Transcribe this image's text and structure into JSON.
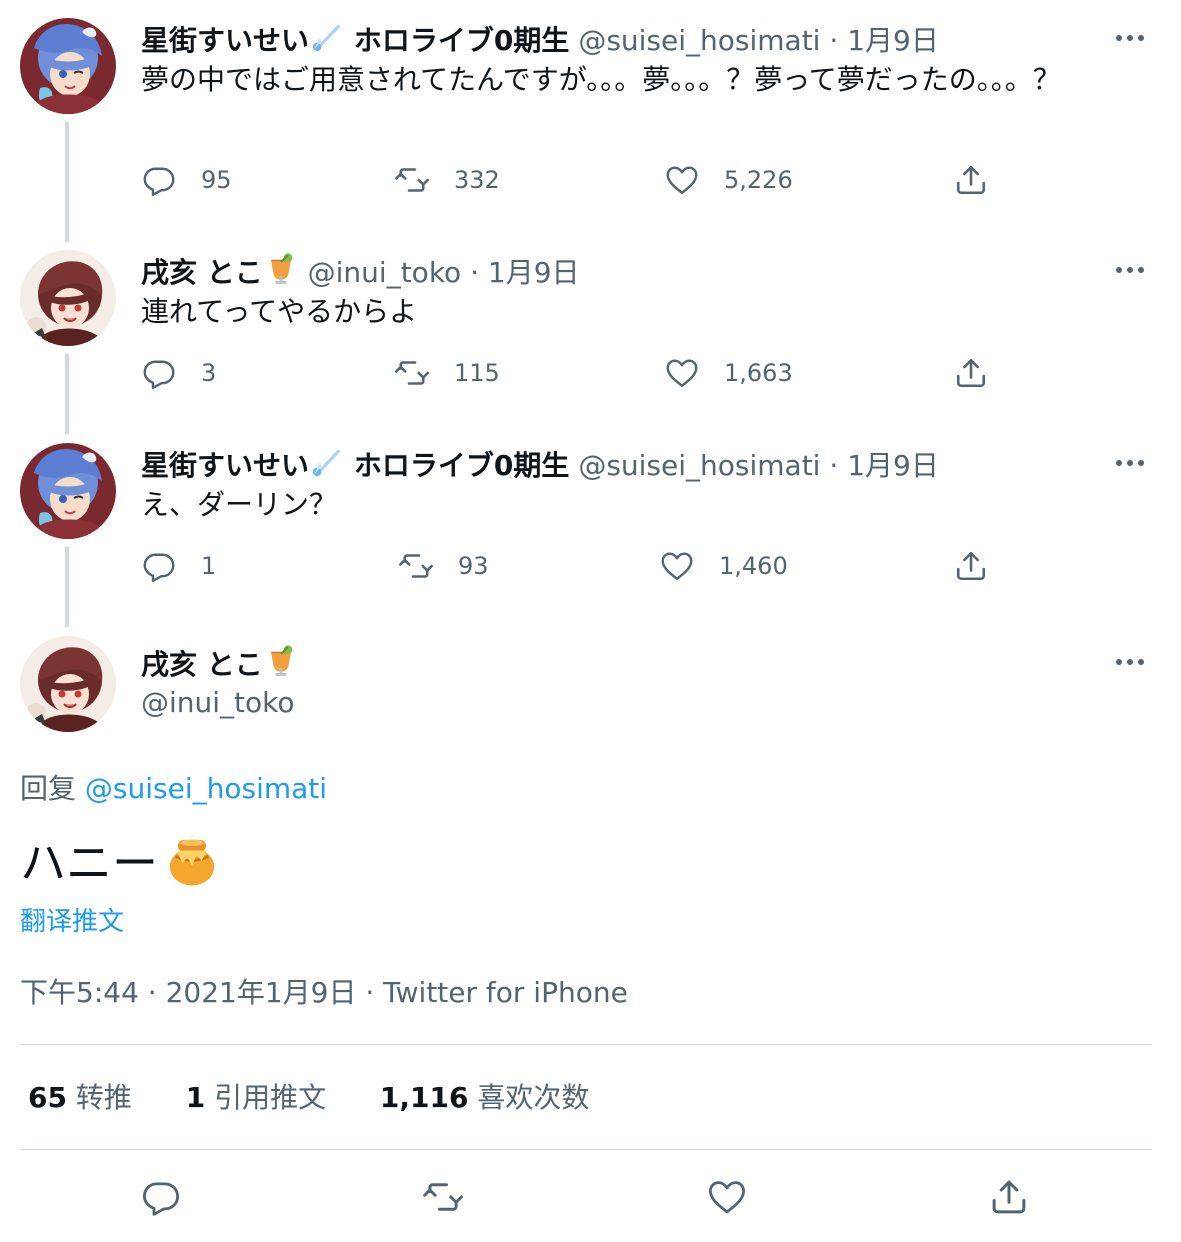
{
  "thread": [
    {
      "name": "星街すいせい",
      "name_suffix": "ホロライブ0期生",
      "name_emoji": "comet-icon",
      "handle": "@suisei_hosimati",
      "separator": "·",
      "date": "1月9日",
      "text": "夢の中ではご用意されてたんですが。。。夢。。。？夢って夢だったの。。。？",
      "replies": "95",
      "retweets": "332",
      "likes": "5,226"
    },
    {
      "name": "戌亥 とこ",
      "name_suffix": "",
      "name_emoji": "cocktail-icon",
      "handle": "@inui_toko",
      "separator": "·",
      "date": "1月9日",
      "text": "連れてってやるからよ",
      "replies": "3",
      "retweets": "115",
      "likes": "1,663"
    },
    {
      "name": "星街すいせい",
      "name_suffix": "ホロライブ0期生",
      "name_emoji": "comet-icon",
      "handle": "@suisei_hosimati",
      "separator": "·",
      "date": "1月9日",
      "text": "え、ダーリン？",
      "replies": "1",
      "retweets": "93",
      "likes": "1,460"
    }
  ],
  "main_tweet": {
    "name": "戌亥 とこ",
    "name_emoji": "cocktail-icon",
    "handle": "@inui_toko",
    "reply_prefix": "回复",
    "reply_to": "@suisei_hosimati",
    "text": "ハニー",
    "text_emoji": "honey-pot-icon",
    "translate": "翻译推文",
    "timestamp": "下午5:44 · 2021年1月9日 · Twitter for iPhone",
    "stats": {
      "retweets_count": "65",
      "retweets_label": "转推",
      "quotes_count": "1",
      "quotes_label": "引用推文",
      "likes_count": "1,116",
      "likes_label": "喜欢次数"
    }
  },
  "colors": {
    "text": "#0f1419",
    "secondary": "#536471",
    "link": "#1d9bf0",
    "divider": "#cfd9de"
  }
}
